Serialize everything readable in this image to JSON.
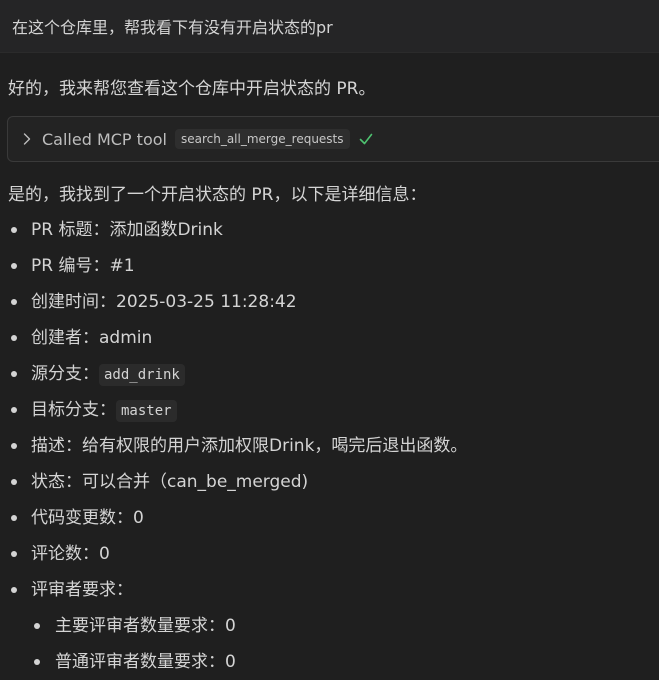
{
  "user_message": "在这个仓库里，帮我看下有没有开启状态的pr",
  "assistant": {
    "intro": "好的，我来帮您查看这个仓库中开启状态的 PR。",
    "tool_call": {
      "label": "Called MCP tool",
      "tool_name": "search_all_merge_requests",
      "status_icon": "check-icon",
      "chevron_icon": "chevron-right-icon",
      "check_color": "#4ec270"
    },
    "summary": "是的，我找到了一个开启状态的 PR，以下是详细信息：",
    "details": [
      {
        "label": "PR 标题：",
        "value": "添加函数Drink"
      },
      {
        "label": "PR 编号：",
        "value": "#1"
      },
      {
        "label": "创建时间：",
        "value": "2025-03-25 11:28:42"
      },
      {
        "label": "创建者：",
        "value": "admin"
      },
      {
        "label": "源分支：",
        "code": "add_drink"
      },
      {
        "label": "目标分支：",
        "code": "master"
      },
      {
        "label": "描述：",
        "value": "给有权限的用户添加权限Drink，喝完后退出函数。"
      },
      {
        "label": "状态：",
        "value": "可以合并（can_be_merged)"
      },
      {
        "label": "代码变更数：",
        "value": "0"
      },
      {
        "label": "评论数：",
        "value": "0"
      },
      {
        "label": "评审者要求：",
        "value": ""
      }
    ],
    "reviewer_requirements": [
      {
        "label": "主要评审者数量要求：",
        "value": "0"
      },
      {
        "label": "普通评审者数量要求：",
        "value": "0"
      }
    ]
  }
}
